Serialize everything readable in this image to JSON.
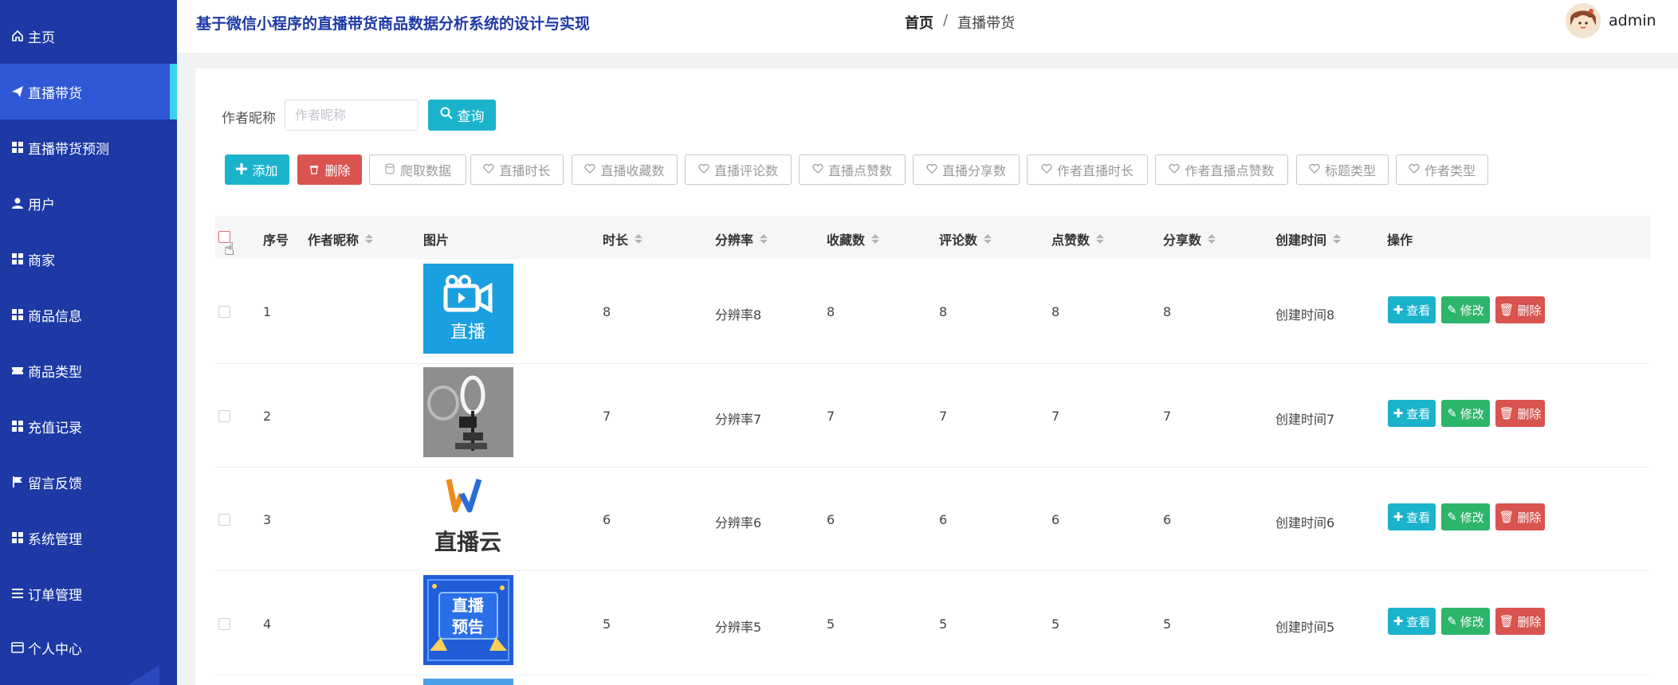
{
  "app": {
    "title": "基于微信小程序的直播带货商品数据分析系统的设计与实现",
    "username": "admin"
  },
  "breadcrumb": {
    "home": "首页",
    "separator": "/",
    "current": "直播带货"
  },
  "sidebar": {
    "items": [
      {
        "label": "主页",
        "icon": "home-icon"
      },
      {
        "label": "直播带货",
        "icon": "send-icon",
        "active": true
      },
      {
        "label": "直播带货预测",
        "icon": "grid-icon"
      },
      {
        "label": "用户",
        "icon": "user-icon"
      },
      {
        "label": "商家",
        "icon": "grid-icon"
      },
      {
        "label": "商品信息",
        "icon": "grid-icon"
      },
      {
        "label": "商品类型",
        "icon": "ticket-icon"
      },
      {
        "label": "充值记录",
        "icon": "grid-icon"
      },
      {
        "label": "留言反馈",
        "icon": "flag-icon"
      },
      {
        "label": "系统管理",
        "icon": "grid-icon"
      },
      {
        "label": "订单管理",
        "icon": "list-icon"
      },
      {
        "label": "个人中心",
        "icon": "card-icon"
      }
    ]
  },
  "search": {
    "label": "作者昵称",
    "placeholder": "作者昵称",
    "button": "查询"
  },
  "toolbar": {
    "add": "添加",
    "delete": "删除",
    "crawl": "爬取数据",
    "stats": [
      "直播时长",
      "直播收藏数",
      "直播评论数",
      "直播点赞数",
      "直播分享数",
      "作者直播时长",
      "作者直播点赞数",
      "标题类型",
      "作者类型"
    ]
  },
  "table": {
    "headers": {
      "index": "序号",
      "author": "作者昵称",
      "image": "图片",
      "duration": "时长",
      "resolution": "分辨率",
      "favorites": "收藏数",
      "comments": "评论数",
      "likes": "点赞数",
      "shares": "分享数",
      "created": "创建时间",
      "actions": "操作"
    },
    "action_labels": {
      "view": "查看",
      "edit": "修改",
      "delete": "删除"
    },
    "rows": [
      {
        "index": "1",
        "author": "",
        "image": "live-camera-logo",
        "duration": "8",
        "resolution": "分辨率8",
        "favorites": "8",
        "comments": "8",
        "likes": "8",
        "shares": "8",
        "created": "创建时间8"
      },
      {
        "index": "2",
        "author": "",
        "image": "ring-light-photo",
        "duration": "7",
        "resolution": "分辨率7",
        "favorites": "7",
        "comments": "7",
        "likes": "7",
        "shares": "7",
        "created": "创建时间7"
      },
      {
        "index": "3",
        "author": "",
        "image": "live-cloud-logo",
        "duration": "6",
        "resolution": "分辨率6",
        "favorites": "6",
        "comments": "6",
        "likes": "6",
        "shares": "6",
        "created": "创建时间6"
      },
      {
        "index": "4",
        "author": "",
        "image": "live-preview-poster",
        "duration": "5",
        "resolution": "分辨率5",
        "favorites": "5",
        "comments": "5",
        "likes": "5",
        "shares": "5",
        "created": "创建时间5"
      }
    ]
  },
  "image_text": {
    "live": "直播",
    "live_cloud": "直播云",
    "preview_line1": "直播",
    "preview_line2": "预告"
  },
  "colors": {
    "sidebar": "#1d39a6",
    "sidebar_active": "#2f57d6",
    "accent": "#3ad0f2",
    "primary": "#1bb3cc",
    "success": "#2db56b",
    "danger": "#d9534f"
  }
}
